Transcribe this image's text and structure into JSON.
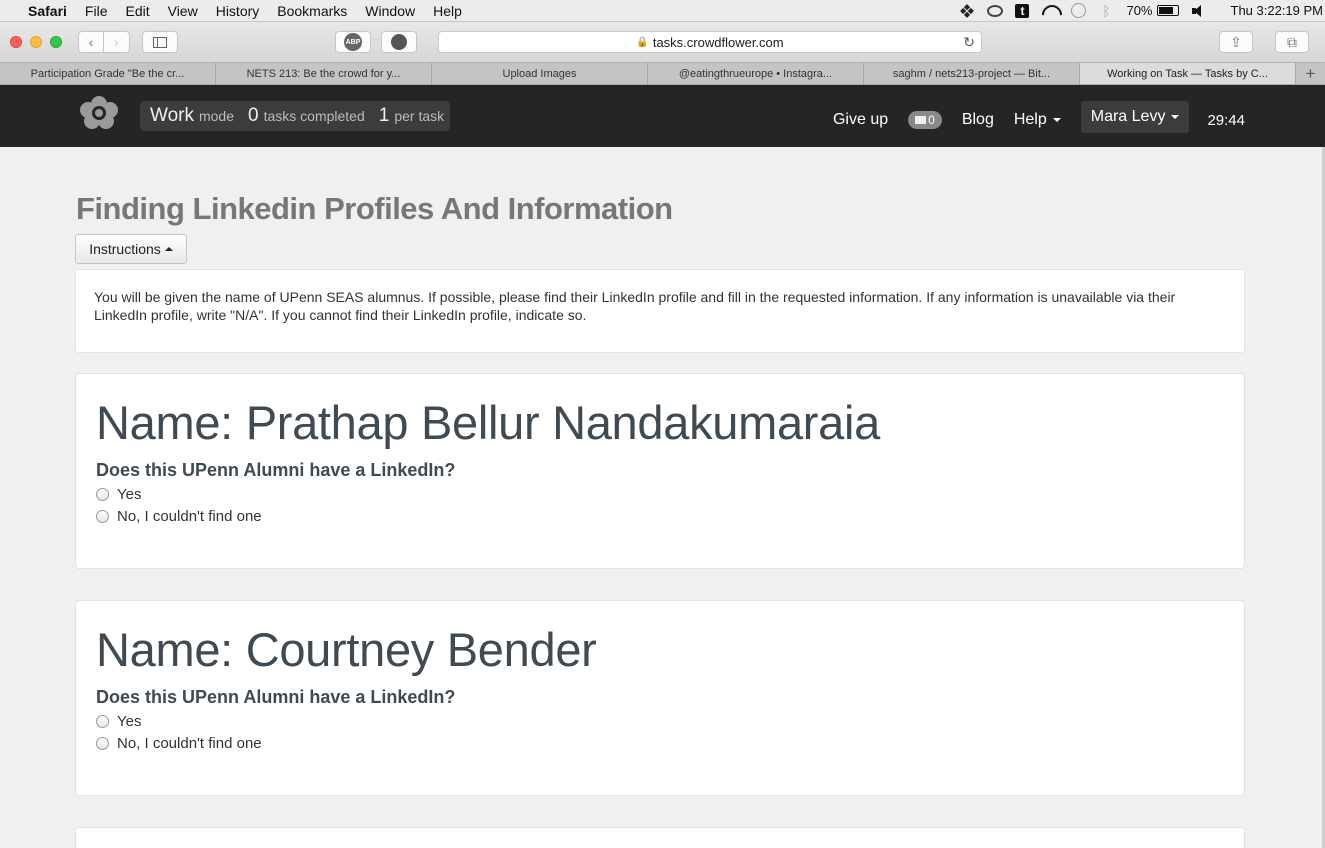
{
  "menubar": {
    "app": "Safari",
    "items": [
      "File",
      "Edit",
      "View",
      "History",
      "Bookmarks",
      "Window",
      "Help"
    ],
    "battery": "70%",
    "clock": "Thu 3:22:19 PM"
  },
  "browser": {
    "url": "tasks.crowdflower.com",
    "extensions": {
      "abp": "ABP"
    },
    "tabs": [
      {
        "label": "Participation Grade \"Be the cr..."
      },
      {
        "label": "NETS 213: Be the crowd for y..."
      },
      {
        "label": "Upload Images"
      },
      {
        "label": "@eatingthrueurope • Instagra..."
      },
      {
        "label": "saghm / nets213-project — Bit..."
      },
      {
        "label": "Working on Task — Tasks by C..."
      }
    ]
  },
  "header": {
    "mode_word": "Work",
    "mode_label": "mode",
    "tasks_count": "0",
    "tasks_label": "tasks completed",
    "per_count": "1",
    "per_label": "per task",
    "give_up": "Give up",
    "messages": "0",
    "blog": "Blog",
    "help": "Help",
    "user": "Mara Levy",
    "timer": "29:44"
  },
  "page": {
    "title": "Finding Linkedin Profiles And Information",
    "instructions_button": "Instructions",
    "instructions_text": "You will be given the name of UPenn SEAS alumnus. If possible, please find their LinkedIn profile and fill in the requested information. If any information is unavailable via their LinkedIn profile, write \"N/A\". If you cannot find their LinkedIn profile, indicate so."
  },
  "cards": [
    {
      "name": "Name: Prathap Bellur Nandakumaraia",
      "question": "Does this UPenn Alumni have a LinkedIn?",
      "options": [
        "Yes",
        "No, I couldn't find one"
      ]
    },
    {
      "name": "Name: Courtney Bender",
      "question": "Does this UPenn Alumni have a LinkedIn?",
      "options": [
        "Yes",
        "No, I couldn't find one"
      ]
    }
  ],
  "colors": {
    "header_bg": "#252525",
    "content_bg": "#f0f0f0",
    "name_heading": "#3f4a52",
    "title_gray": "#777777"
  }
}
